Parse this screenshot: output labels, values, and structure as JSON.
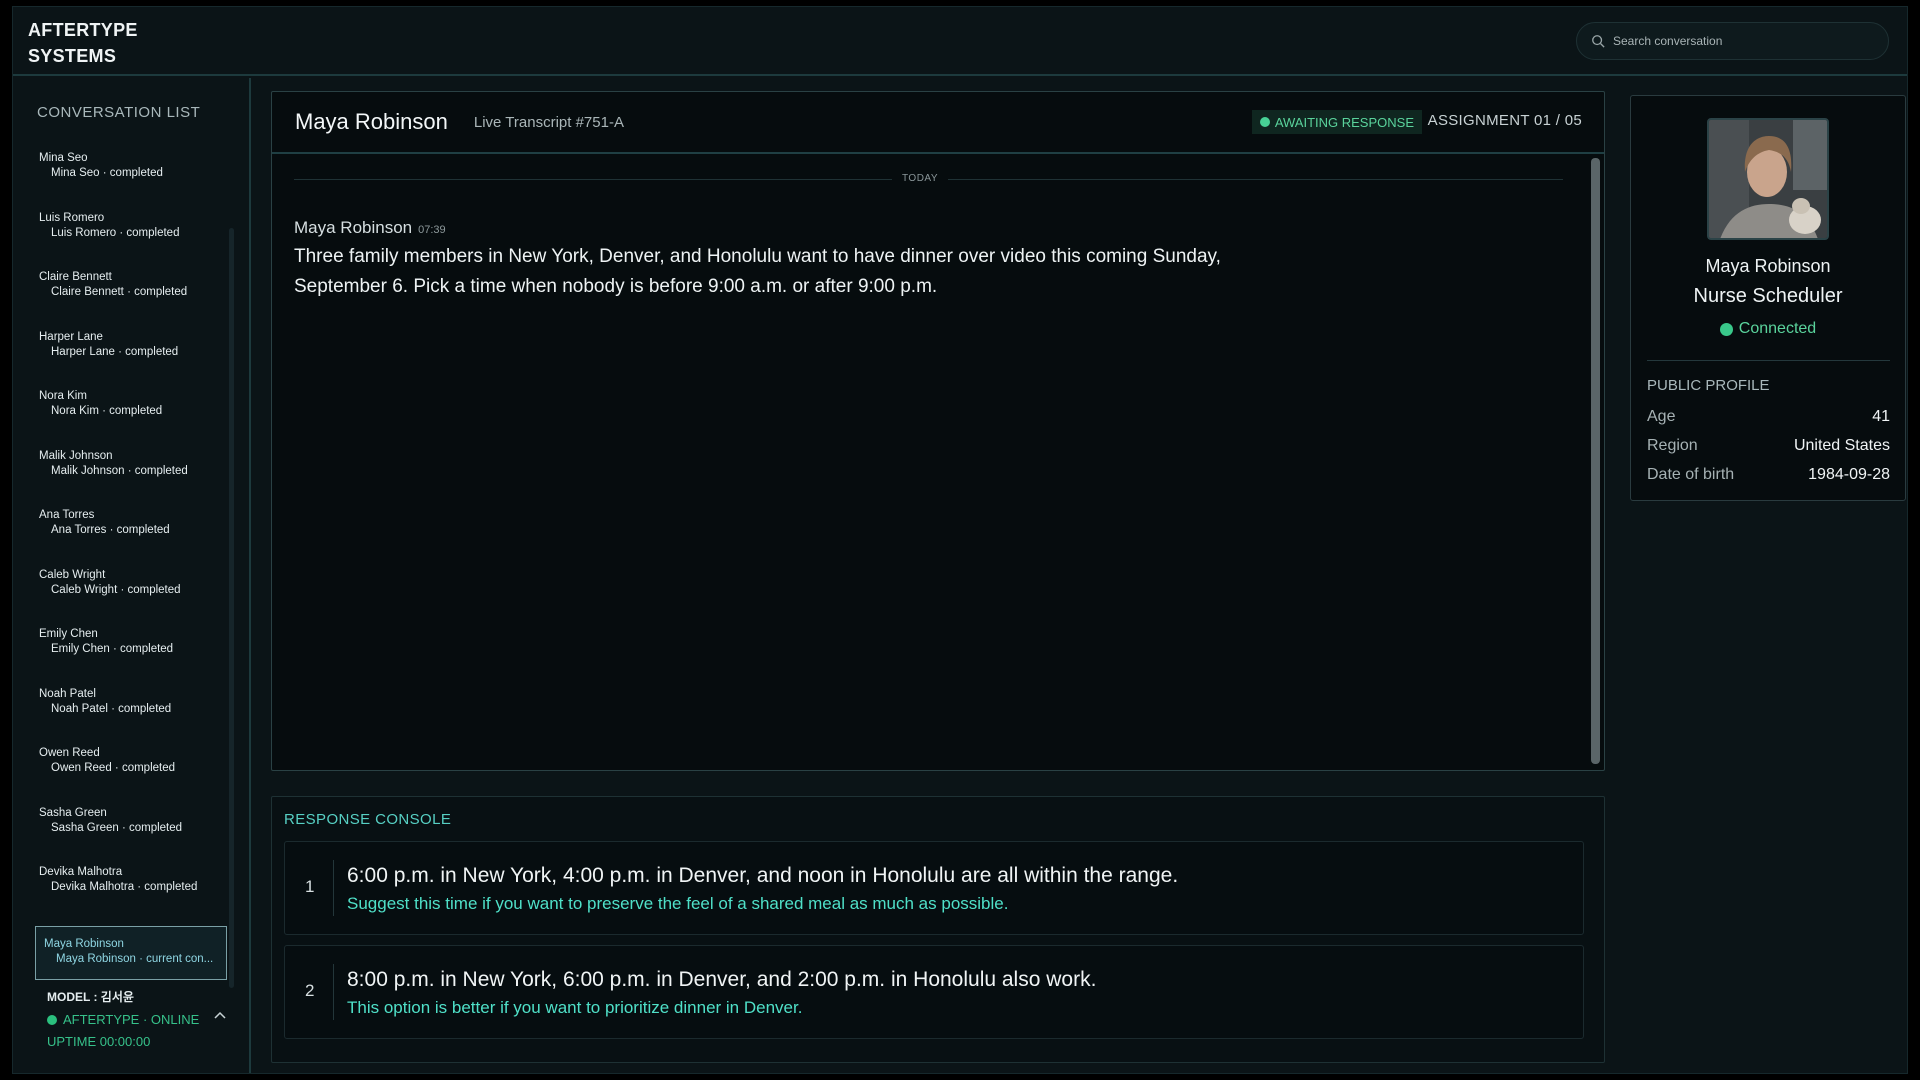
{
  "brand": {
    "line1": "AFTERTYPE",
    "line2": "SYSTEMS"
  },
  "search": {
    "placeholder": "Search conversation",
    "icon": "search-icon"
  },
  "sidebar": {
    "title": "CONVERSATION LIST",
    "items": [
      {
        "name": "Mina Seo",
        "sub": "Mina Seo · completed"
      },
      {
        "name": "Luis Romero",
        "sub": "Luis Romero · completed"
      },
      {
        "name": "Claire Bennett",
        "sub": "Claire Bennett · completed"
      },
      {
        "name": "Harper Lane",
        "sub": "Harper Lane · completed"
      },
      {
        "name": "Nora Kim",
        "sub": "Nora Kim · completed"
      },
      {
        "name": "Malik Johnson",
        "sub": "Malik Johnson · completed"
      },
      {
        "name": "Ana Torres",
        "sub": "Ana Torres · completed"
      },
      {
        "name": "Caleb Wright",
        "sub": "Caleb Wright · completed"
      },
      {
        "name": "Emily Chen",
        "sub": "Emily Chen · completed"
      },
      {
        "name": "Noah Patel",
        "sub": "Noah Patel · completed"
      },
      {
        "name": "Owen Reed",
        "sub": "Owen Reed · completed"
      },
      {
        "name": "Sasha Green",
        "sub": "Sasha Green · completed"
      },
      {
        "name": "Devika Malhotra",
        "sub": "Devika Malhotra · completed"
      },
      {
        "name": "Maya Robinson",
        "sub": "Maya Robinson · current con..."
      }
    ],
    "model": {
      "label": "MODEL : 김서윤",
      "status": "AFTERTYPE · ONLINE",
      "uptime": "UPTIME 00:00:00",
      "toggle": "^"
    }
  },
  "conversation": {
    "title": "Maya Robinson",
    "transcript": "Live Transcript #751-A",
    "status": "AWAITING RESPONSE",
    "assignment": "ASSIGNMENT 01 / 05",
    "day_label": "TODAY",
    "message": {
      "author": "Maya Robinson",
      "time": "07:39",
      "line1": "Three family members in New York, Denver, and Honolulu want to have dinner over video this coming Sunday,",
      "line2": "September 6. Pick a time when nobody is before 9:00 a.m. or after 9:00 p.m."
    }
  },
  "console": {
    "title": "RESPONSE CONSOLE",
    "options": [
      {
        "num": "1",
        "main": "6:00 p.m. in New York, 4:00 p.m. in Denver, and noon in Honolulu are all within the range.",
        "hint": "Suggest this time if you want to preserve the feel of a shared meal as much as possible."
      },
      {
        "num": "2",
        "main": "8:00 p.m. in New York, 6:00 p.m. in Denver, and 2:00 p.m. in Honolulu also work.",
        "hint": "This option is better if you want to prioritize dinner in Denver."
      }
    ]
  },
  "profile": {
    "name": "Maya Robinson",
    "role": "Nurse Scheduler",
    "connection": "Connected",
    "section_title": "PUBLIC PROFILE",
    "details": [
      {
        "key": "Age",
        "value": "41"
      },
      {
        "key": "Region",
        "value": "United States"
      },
      {
        "key": "Date of birth",
        "value": "1984-09-28"
      }
    ]
  },
  "colors": {
    "accent_teal": "#4fe0c8",
    "status_green": "#39c88a",
    "background": "#0b1417"
  }
}
